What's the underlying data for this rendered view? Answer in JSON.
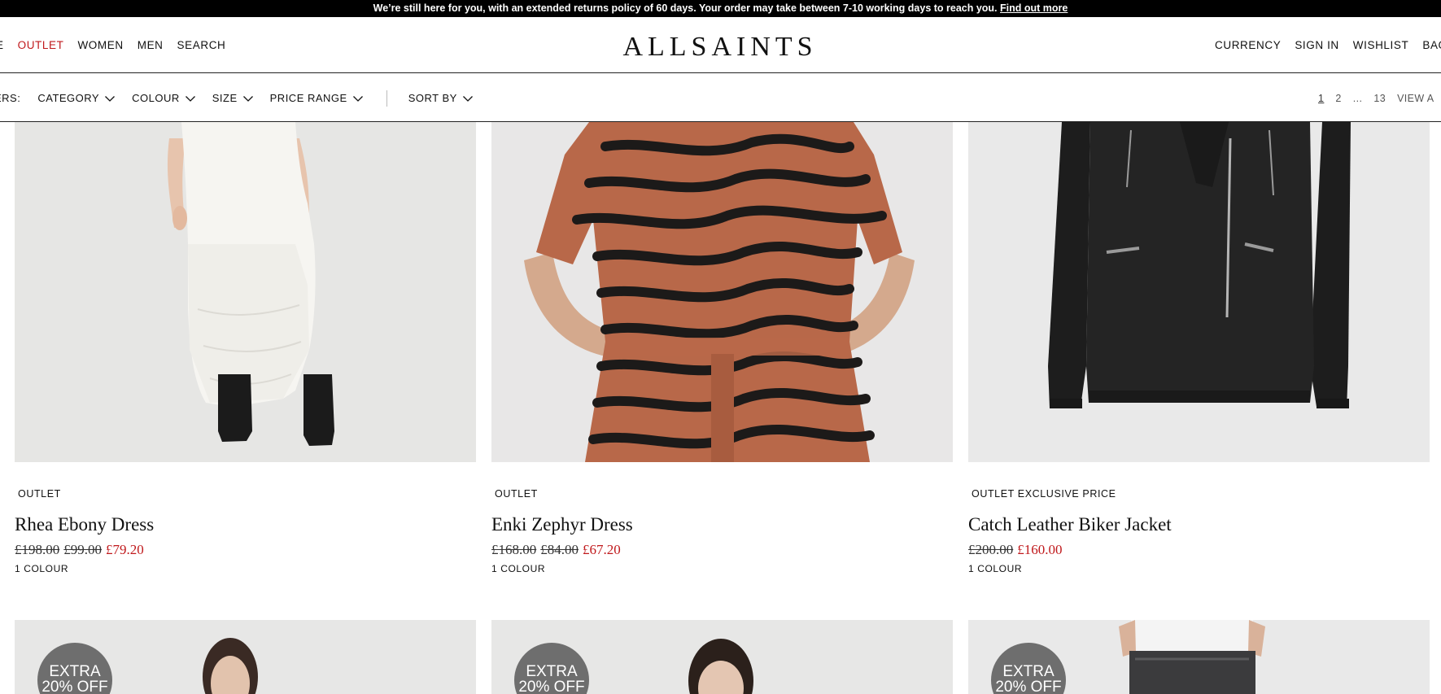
{
  "announcement": {
    "text": "We’re still here for you, with an extended returns policy of 60 days. Your order may take between 7-10 working days to reach you.",
    "link": "Find out more"
  },
  "header": {
    "logo": "ALLSAINTS",
    "nav_left": [
      "E",
      "OUTLET",
      "WOMEN",
      "MEN",
      "SEARCH"
    ],
    "nav_right": [
      "CURRENCY",
      "SIGN IN",
      "WISHLIST",
      "BAG"
    ]
  },
  "filters": {
    "label": "ERS:",
    "items": [
      "CATEGORY",
      "COLOUR",
      "SIZE",
      "PRICE RANGE"
    ],
    "sort": "SORT BY",
    "pages": [
      "1",
      "2",
      "...",
      "13"
    ],
    "view_all": "VIEW A"
  },
  "products": [
    {
      "tag": "OUTLET",
      "name": "Rhea Ebony Dress",
      "old_prices": [
        "£198.00",
        "£99.00"
      ],
      "price": "£79.20",
      "colours": "1 COLOUR"
    },
    {
      "tag": "OUTLET",
      "name": "Enki Zephyr Dress",
      "old_prices": [
        "£168.00",
        "£84.00"
      ],
      "price": "£67.20",
      "colours": "1 COLOUR"
    },
    {
      "tag": "OUTLET EXCLUSIVE PRICE",
      "name": "Catch Leather Biker Jacket",
      "old_prices": [
        "£200.00"
      ],
      "price": "£160.00",
      "colours": "1 COLOUR"
    }
  ],
  "next_row": {
    "badge_line1": "EXTRA",
    "badge_line2": "20% OFF"
  },
  "colors": {
    "accent_red": "#c0191c",
    "image_bg": "#e9e9e9",
    "badge_grey": "#6e6e6e"
  }
}
